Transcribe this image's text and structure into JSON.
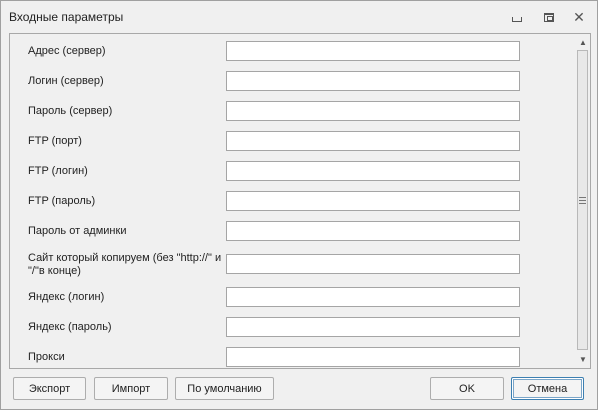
{
  "window": {
    "title": "Входные параметры"
  },
  "fields": [
    {
      "label": "Адрес (сервер)",
      "value": "",
      "name": "server-address"
    },
    {
      "label": "Логин (сервер)",
      "value": "",
      "name": "server-login"
    },
    {
      "label": "Пароль (сервер)",
      "value": "",
      "name": "server-password"
    },
    {
      "label": "FTP (порт)",
      "value": "",
      "name": "ftp-port"
    },
    {
      "label": "FTP (логин)",
      "value": "",
      "name": "ftp-login"
    },
    {
      "label": "FTP (пароль)",
      "value": "",
      "name": "ftp-password"
    },
    {
      "label": "Пароль от админки",
      "value": "",
      "name": "admin-password"
    },
    {
      "label": "Сайт который копируем (без \"http://\" и \"/\"в конце)",
      "value": "",
      "name": "source-site"
    },
    {
      "label": "Яндекс (логин)",
      "value": "",
      "name": "yandex-login"
    },
    {
      "label": "Яндекс (пароль)",
      "value": "",
      "name": "yandex-password"
    },
    {
      "label": "Прокси",
      "value": "",
      "name": "proxy"
    }
  ],
  "buttons": {
    "export": "Экспорт",
    "import": "Импорт",
    "defaults": "По умолчанию",
    "ok": "OK",
    "cancel": "Отмена"
  },
  "icons": {
    "minimize": "minimize-icon",
    "maximize": "maximize-icon",
    "close": "close-icon",
    "scroll_up": "arrow-up-icon",
    "scroll_down": "arrow-down-icon"
  }
}
